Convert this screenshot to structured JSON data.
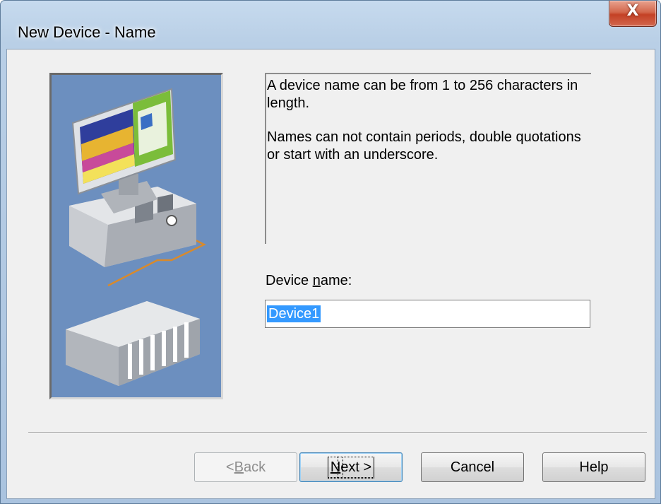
{
  "window": {
    "title": "New Device - Name",
    "close_glyph": "X"
  },
  "info": {
    "paragraph1": "A device name can be from 1 to 256 characters in length.",
    "paragraph2": "Names can not contain periods, double quotations or start with an underscore."
  },
  "device_name": {
    "label_pre": "Device ",
    "label_access": "n",
    "label_post": "ame:",
    "value": "Device1"
  },
  "buttons": {
    "back": {
      "pre": "< ",
      "access": "B",
      "post": "ack",
      "enabled": false
    },
    "next": {
      "pre": "",
      "access": "N",
      "post": "ext >",
      "default": true
    },
    "cancel": {
      "label": "Cancel"
    },
    "help": {
      "label": "Help"
    }
  },
  "icons": {
    "close": "close-icon",
    "illustration": "computer-and-plc-illustration"
  },
  "colors": {
    "illustration_bg": "#6c8fbf",
    "selection": "#3399ff",
    "close_button": "#c44125"
  }
}
